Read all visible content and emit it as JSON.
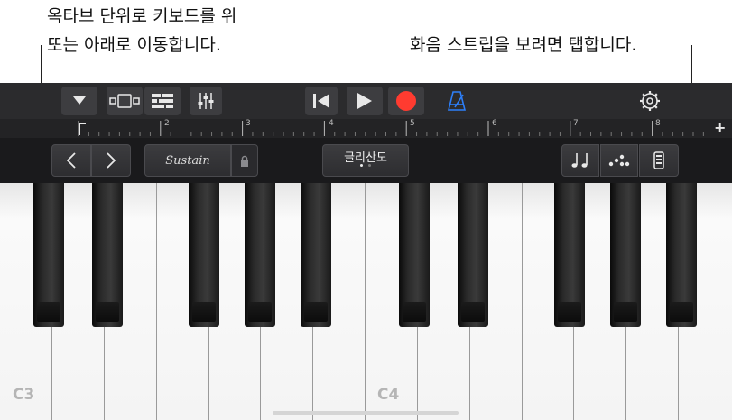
{
  "callouts": {
    "octave_line1": "옥타브 단위로 키보드를 위",
    "octave_line2": "또는 아래로 이동합니다.",
    "chord_strip": "화음 스트립을 보려면 탭합니다."
  },
  "control_bar": {
    "icons": [
      "dropdown-triangle-icon",
      "view-toggle-icon",
      "tracks-view-icon",
      "mixer-icon",
      "rewind-icon",
      "play-icon",
      "record-icon",
      "metronome-icon",
      "settings-gear-icon"
    ],
    "record_color": "#ff3b30",
    "metronome_color": "#2d7ff9"
  },
  "ruler": {
    "bars": [
      "2",
      "3",
      "4",
      "5",
      "6",
      "7",
      "8"
    ],
    "add_label": "+"
  },
  "keyboard_controls": {
    "octave_down_icon": "chevron-left-icon",
    "octave_up_icon": "chevron-right-icon",
    "sustain_label": "Sustain",
    "glissando_label": "글리산도",
    "right_icons": [
      "notes-icon",
      "arpeggiator-icon",
      "chord-strip-icon"
    ]
  },
  "keyboard": {
    "labels": {
      "c3": "C3",
      "c4": "C4"
    }
  }
}
